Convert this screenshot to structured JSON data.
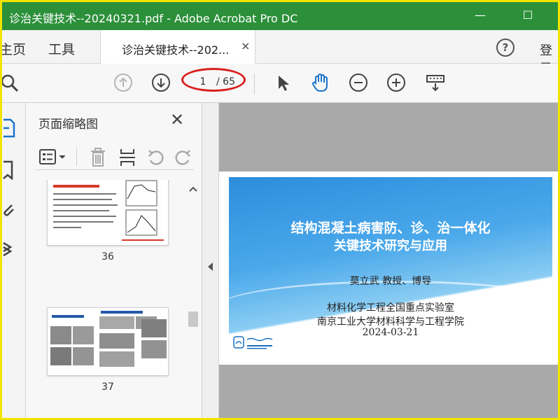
{
  "window": {
    "title": "诊治关键技术--20240321.pdf - Adobe Acrobat Pro DC",
    "minimize": "—",
    "maximize": "☐"
  },
  "menu": {
    "home": "主页",
    "tools": "工具",
    "doc_tab": "诊治关键技术--202...",
    "doc_tab_close": "×",
    "help": "?",
    "login": "登录"
  },
  "toolbar": {
    "current_page": "1",
    "total_pages": "/ 65"
  },
  "thumbnails_panel": {
    "title": "页面缩略图",
    "close": "✕",
    "pages": [
      {
        "number": "36"
      },
      {
        "number": "37"
      }
    ]
  },
  "slide": {
    "title_line1": "结构混凝土病害防、诊、治一体化",
    "title_line2": "关键技术研究与应用",
    "author": "莫立武 教授、博导",
    "org_line1": "材料化学工程全国重点实验室",
    "org_line2": "南京工业大学材料科学与工程学院",
    "date": "2024-03-21"
  },
  "colors": {
    "titlebar": "#2c8f3a",
    "annotation_ellipse": "#d8201e",
    "frame": "#f2e400",
    "slide_blue": "#2d8ddc"
  }
}
